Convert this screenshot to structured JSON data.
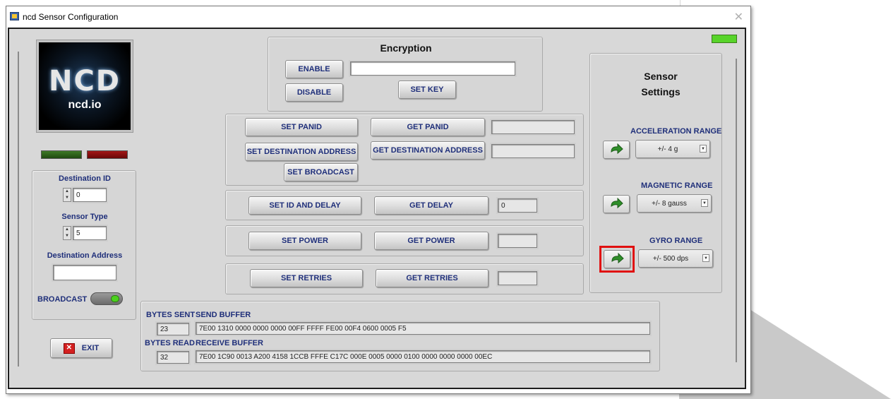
{
  "window": {
    "title": "ncd Sensor Configuration",
    "close_glyph": "✕"
  },
  "logo": {
    "brand": "NCD",
    "site": "ncd.io"
  },
  "colors": {
    "label_blue": "#1f2f7a",
    "led_green": "#4caf1f",
    "led_red": "#8b1010",
    "highlight_red": "#e01010"
  },
  "encryption": {
    "title": "Encryption",
    "enable_label": "ENABLE",
    "disable_label": "DISABLE",
    "set_key_label": "SET KEY",
    "key_value": ""
  },
  "network": {
    "set_panid_label": "SET PANID",
    "get_panid_label": "GET PANID",
    "panid_value": "",
    "set_dest_label": "SET DESTINATION ADDRESS",
    "get_dest_label": "GET DESTINATION ADDRESS",
    "dest_value": "",
    "set_broadcast_label": "SET BROADCAST"
  },
  "id_delay": {
    "set_label": "SET ID AND DELAY",
    "get_label": "GET DELAY",
    "value": "0"
  },
  "power": {
    "set_label": "SET POWER",
    "get_label": "GET POWER",
    "value": ""
  },
  "retries": {
    "set_label": "SET RETRIES",
    "get_label": "GET RETRIES",
    "value": ""
  },
  "left_panel": {
    "dest_id_label": "Destination ID",
    "dest_id_value": "0",
    "sensor_type_label": "Sensor Type",
    "sensor_type_value": "5",
    "dest_address_label": "Destination Address",
    "dest_address_value": "",
    "broadcast_label": "BROADCAST"
  },
  "exit": {
    "label": "EXIT",
    "icon": "close-box-icon"
  },
  "buffers": {
    "bytes_sent_label": "BYTES SENT",
    "bytes_sent_value": "23",
    "send_label": "SEND BUFFER",
    "send_value": "7E00 1310 0000 0000 0000 00FF FFFF FE00 00F4 0600 0005 F5",
    "bytes_read_label": "BYTES READ",
    "bytes_read_value": "32",
    "receive_label": "RECEIVE BUFFER",
    "receive_value": "7E00 1C90 0013 A200 4158 1CCB FFFE C17C 000E 0005 0000 0100 0000 0000 0000 00EC"
  },
  "sensor": {
    "title_line1": "Sensor",
    "title_line2": "Settings",
    "accel_label": "ACCELERATION RANGE",
    "accel_value": "+/- 4 g",
    "mag_label": "MAGNETIC RANGE",
    "mag_value": "+/- 8 gauss",
    "gyro_label": "GYRO RANGE",
    "gyro_value": "+/- 500 dps"
  }
}
